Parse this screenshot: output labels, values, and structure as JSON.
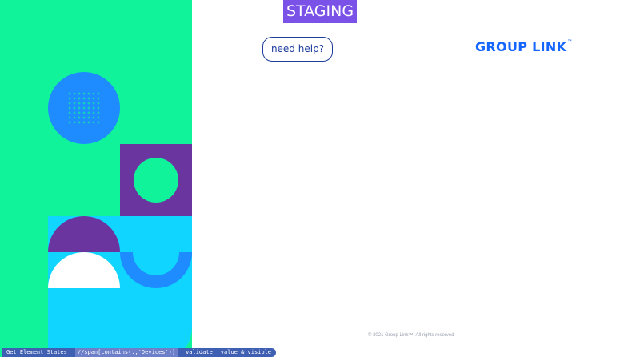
{
  "environment_badge": "STAGING",
  "help_button": {
    "label": "need help?"
  },
  "brand": {
    "name": "GROUP LINK",
    "tm": "™"
  },
  "footer": {
    "copyright": "© 2021 Group Link™. All rights reserved"
  },
  "debug_overlay": {
    "keyword": "Get Element States",
    "locator": "//span[contains(.,'Devices')]",
    "assertion": "validate",
    "states": "value & visible"
  },
  "colors": {
    "panel_green": "#11f39b",
    "accent_blue": "#1e8bff",
    "purple": "#6b35a0",
    "cyan": "#0fd5ff",
    "staging_purple": "#7b52e8",
    "brand_blue": "#1565ff",
    "help_navy": "#1f3d9c"
  }
}
